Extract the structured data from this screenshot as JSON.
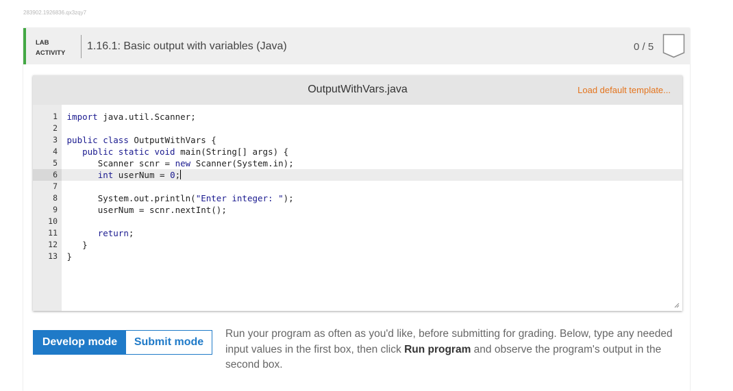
{
  "watermark": "283902.1926836.qx3zqy7",
  "header": {
    "tag_line1": "LAB",
    "tag_line2": "ACTIVITY",
    "title": "1.16.1: Basic output with variables (Java)",
    "score": "0 / 5"
  },
  "editor": {
    "file_name": "OutputWithVars.java",
    "load_template_label": "Load default template...",
    "line_numbers": [
      "1",
      "2",
      "3",
      "4",
      "5",
      "6",
      "7",
      "8",
      "9",
      "10",
      "11",
      "12",
      "13"
    ],
    "lines": [
      "import java.util.Scanner;",
      "",
      "public class OutputWithVars {",
      "   public static void main(String[] args) {",
      "      Scanner scnr = new Scanner(System.in);",
      "      int userNum = 0;",
      "",
      "      System.out.println(\"Enter integer: \");",
      "      userNum = scnr.nextInt();",
      "",
      "      return;",
      "   }",
      "}"
    ],
    "active_line": 6
  },
  "modes": {
    "develop_label": "Develop mode",
    "submit_label": "Submit mode",
    "active": "develop"
  },
  "instructions": {
    "part1": "Run your program as often as you'd like, before submitting for grading. Below, type any needed input values in the first box, then click ",
    "bold": "Run program",
    "part2": " and observe the program's output in the second box."
  },
  "colors": {
    "accent_green": "#44a845",
    "accent_blue": "#1f7ac8",
    "link_orange": "#e4741d"
  }
}
